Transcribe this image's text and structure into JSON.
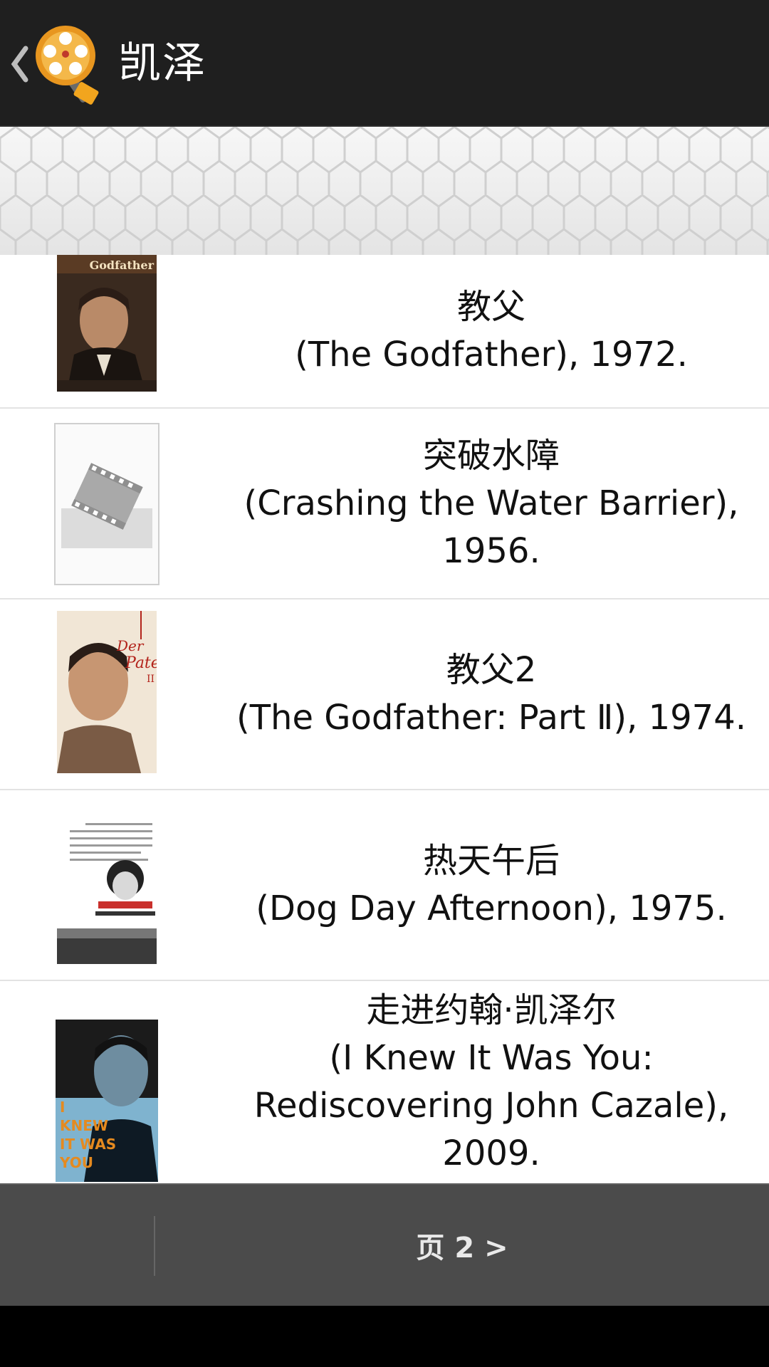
{
  "app": {
    "title": "凯泽"
  },
  "movies": [
    {
      "title_cn": "教父",
      "title_en": "(The Godfather), 1972.",
      "poster": "godfather-poster"
    },
    {
      "title_cn": "突破水障",
      "title_en": "(Crashing the Water Barrier),",
      "year_line": "1956.",
      "poster": "film-placeholder-icon"
    },
    {
      "title_cn": "教父2",
      "title_en": "(The Godfather: Part Ⅱ), 1974.",
      "poster": "godfather-2-poster"
    },
    {
      "title_cn": "热天午后",
      "title_en": "(Dog Day Afternoon), 1975.",
      "poster": "dog-day-afternoon-poster"
    },
    {
      "title_cn": "走进约翰·凯泽尔",
      "title_en": "(I Knew It Was You:",
      "title_en_2": "Rediscovering John Cazale),",
      "year_line": "2009.",
      "poster": "i-knew-it-was-you-poster"
    }
  ],
  "footer": {
    "next_page_label": "页 2 >"
  },
  "colors": {
    "action_bar": "#1f1f1f",
    "bottom_bar": "#4b4b4b",
    "list_background": "#ffffff"
  }
}
